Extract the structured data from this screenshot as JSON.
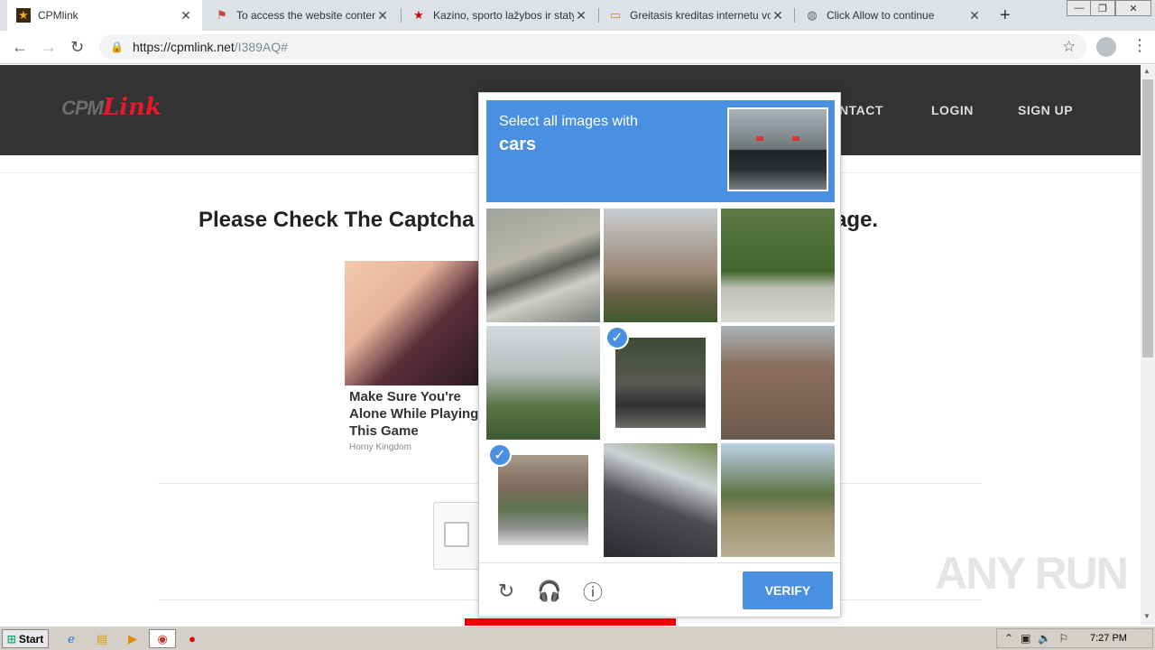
{
  "browser": {
    "tabs": [
      {
        "title": "CPMlink",
        "icon": "star-favicon"
      },
      {
        "title": "To access the website content, y",
        "icon": "flag-favicon"
      },
      {
        "title": "Kazino, sporto lažybos ir statym",
        "icon": "red-star-favicon"
      },
      {
        "title": "Greitasis kreditas internetu vos",
        "icon": "chat-favicon"
      },
      {
        "title": "Click Allow to continue",
        "icon": "globe-favicon"
      }
    ],
    "url_host": "https://cpmlink.net",
    "url_path": "/I389AQ#"
  },
  "site": {
    "nav": [
      "NTACT",
      "LOGIN",
      "SIGN UP"
    ],
    "logo_cpm": "CPM",
    "logo_link": "Link",
    "heading": "Please Check The Captcha Below To Reach The Destination Page.",
    "ad_title": "Make Sure You're Alone While Playing This Game",
    "ad_source": "Horny Kingdom"
  },
  "captcha": {
    "instruction": "Select all images with",
    "target": "cars",
    "verify_label": "VERIFY",
    "selected_tiles": [
      4,
      6
    ]
  },
  "watermark": "ANY RUN",
  "taskbar": {
    "start_label": "Start",
    "clock": "7:27 PM"
  }
}
